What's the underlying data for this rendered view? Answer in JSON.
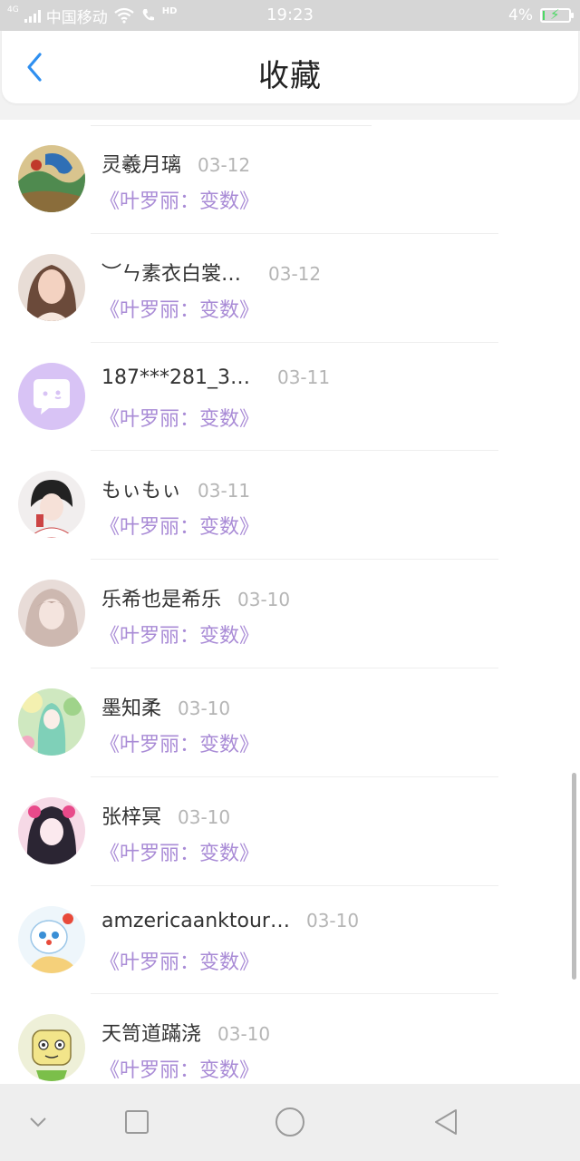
{
  "status_bar": {
    "network_type": "4G",
    "carrier": "中国移动",
    "hd_label": "HD",
    "time": "19:23",
    "battery_text": "4%",
    "battery_level": 0.04
  },
  "header": {
    "title": "收藏"
  },
  "items": [
    {
      "username": "灵羲月璃",
      "date": "03-12",
      "title": "《叶罗丽：变数》"
    },
    {
      "username": "︶ㄣ素衣白裳…",
      "date": "03-12",
      "title": "《叶罗丽：变数》"
    },
    {
      "username": "187***281_3…",
      "date": "03-11",
      "title": "《叶罗丽：变数》"
    },
    {
      "username": "もぃもぃ",
      "date": "03-11",
      "title": "《叶罗丽：变数》"
    },
    {
      "username": "乐希也是希乐",
      "date": "03-10",
      "title": "《叶罗丽：变数》"
    },
    {
      "username": "墨知柔",
      "date": "03-10",
      "title": "《叶罗丽：变数》"
    },
    {
      "username": "张梓冥",
      "date": "03-10",
      "title": "《叶罗丽：变数》"
    },
    {
      "username": "amzericaanktour…",
      "date": "03-10",
      "title": "《叶罗丽：变数》"
    },
    {
      "username": "天笥道蹣浇",
      "date": "03-10",
      "title": "《叶罗丽：变数》"
    }
  ],
  "colors": {
    "accent_blue": "#2e8ff0",
    "title_purple": "#a98bd6",
    "default_avatar_bg": "#d8c3f5"
  },
  "icons": {
    "back": "chevron-left-icon",
    "nav_down": "chevron-down-icon",
    "nav_recent": "square-icon",
    "nav_home": "circle-icon",
    "nav_back": "triangle-back-icon"
  }
}
